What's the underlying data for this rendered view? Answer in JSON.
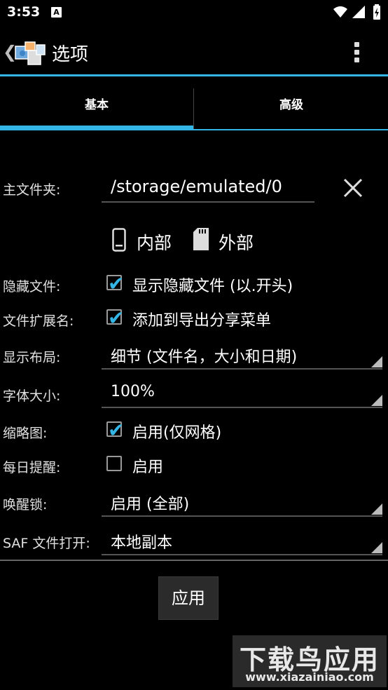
{
  "status_bar": {
    "time": "3:53",
    "notif_icon": "A"
  },
  "action_bar": {
    "title": "选项",
    "back_icon": "chevron-left-icon",
    "menu_icon": "overflow-menu-icon"
  },
  "tabs": [
    {
      "label": "基本",
      "selected": true
    },
    {
      "label": "高级",
      "selected": false
    }
  ],
  "accent_color": "#33b5e5",
  "home_folder": {
    "label": "主文件夹:",
    "value": "/storage/emulated/0",
    "clear_icon": "close-icon"
  },
  "storage": {
    "internal_label": "内部",
    "external_label": "外部"
  },
  "hidden_files": {
    "label": "隐藏文件:",
    "checkbox_label": "显示隐藏文件 (以.开头)",
    "checked": true
  },
  "file_ext": {
    "label": "文件扩展名:",
    "checkbox_label": "添加到导出分享菜单",
    "checked": true
  },
  "layout": {
    "label": "显示布局:",
    "value": "细节 (文件名，大小和日期)"
  },
  "font_size": {
    "label": "字体大小:",
    "value": "100%"
  },
  "thumbnails": {
    "label": "缩略图:",
    "checkbox_label": "启用(仅网格)",
    "checked": true
  },
  "daily_reminder": {
    "label": "每日提醒:",
    "checkbox_label": "启用",
    "checked": false
  },
  "wake_lock": {
    "label": "唤醒锁:",
    "value": "启用 (全部)"
  },
  "saf_open": {
    "label": "SAF 文件打开:",
    "value": "本地副本"
  },
  "apply_button": "应用",
  "watermark": {
    "title": "下载鸟应用",
    "url": "www.xiazainiao.com"
  }
}
